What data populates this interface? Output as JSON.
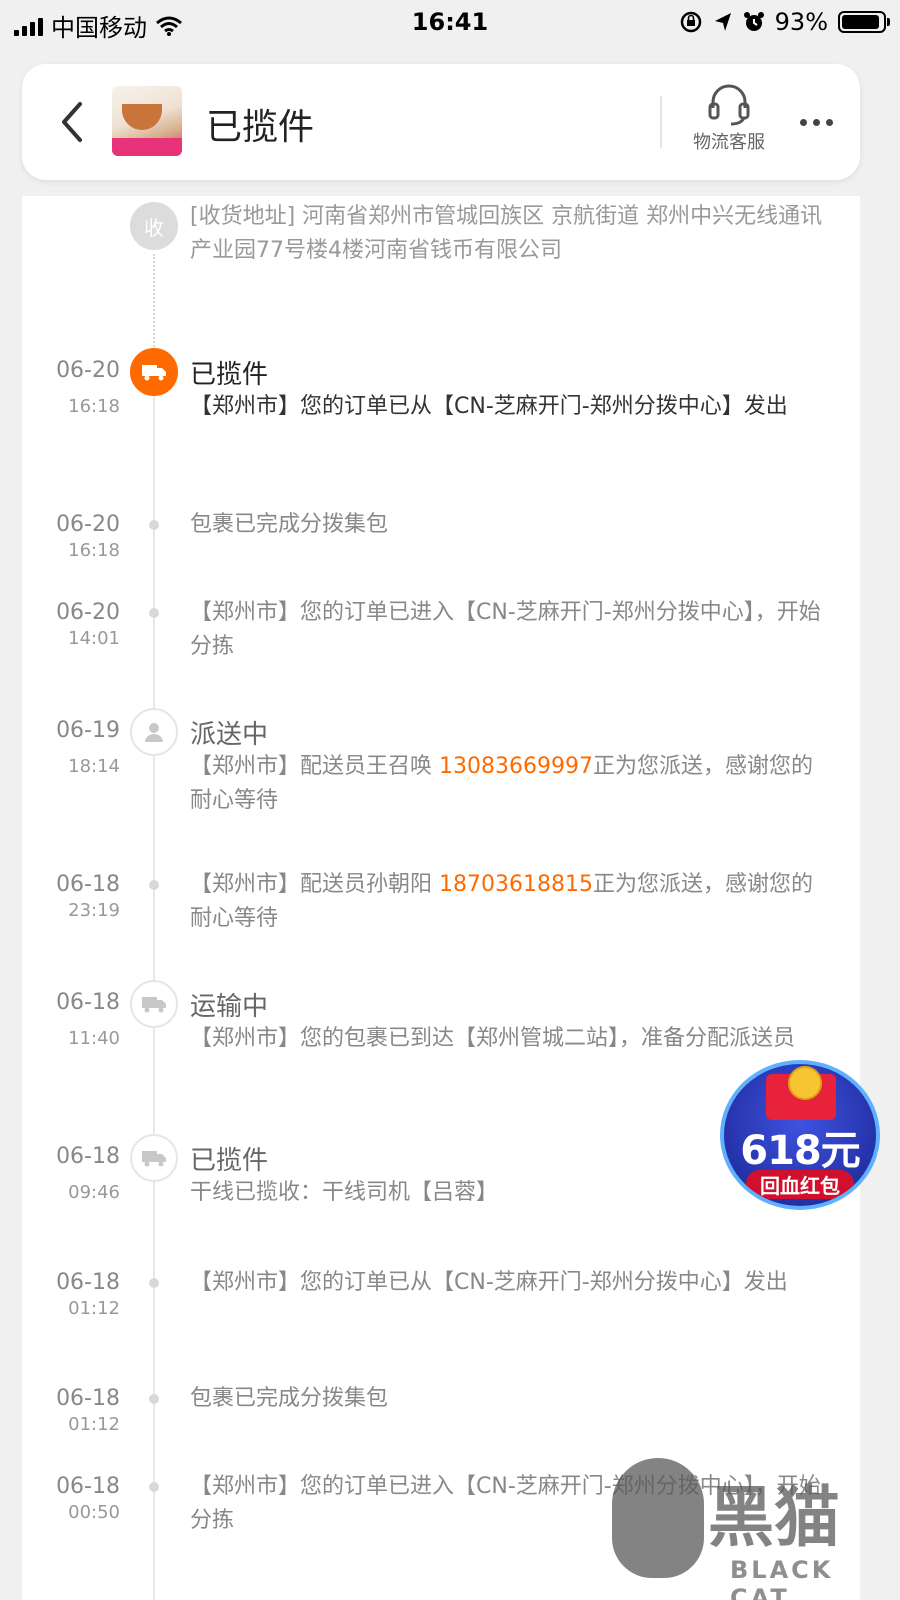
{
  "status_bar": {
    "carrier": "中国移动",
    "time": "16:41",
    "battery_text": "93%",
    "battery_level": 0.93,
    "icons": [
      "signal-icon",
      "wifi-icon",
      "rotation-lock-icon",
      "location-icon",
      "alarm-icon",
      "battery-icon"
    ]
  },
  "header": {
    "title": "已揽件",
    "service_label": "物流客服",
    "icons": [
      "back-arrow-icon",
      "headset-icon",
      "more-icon"
    ]
  },
  "address": {
    "text": "[收货地址] 河南省郑州市管城回族区 京航街道 郑州中兴无线通讯产业园77号楼4楼河南省钱币有限公司",
    "marker_label": "收"
  },
  "events": [
    {
      "date": "06-20",
      "time": "16:18",
      "status": "已揽件",
      "desc": "【郑州市】您的订单已从【CN-芝麻开门-郑州分拨中心】发出",
      "icon": "truck-icon",
      "active": true
    },
    {
      "date": "06-20",
      "time": "16:18",
      "status": "",
      "desc": "包裹已完成分拨集包"
    },
    {
      "date": "06-20",
      "time": "14:01",
      "status": "",
      "desc": "【郑州市】您的订单已进入【CN-芝麻开门-郑州分拨中心】，开始分拣"
    },
    {
      "date": "06-19",
      "time": "18:14",
      "status": "派送中",
      "desc_pre": "【郑州市】配送员王召唤 ",
      "phone": "13083669997",
      "desc_post": "正为您派送，感谢您的耐心等待",
      "icon": "person-icon"
    },
    {
      "date": "06-18",
      "time": "23:19",
      "status": "",
      "desc_pre": "【郑州市】配送员孙朝阳 ",
      "phone": "18703618815",
      "desc_post": "正为您派送，感谢您的耐心等待"
    },
    {
      "date": "06-18",
      "time": "11:40",
      "status": "运输中",
      "desc": "【郑州市】您的包裹已到达【郑州管城二站】，准备分配派送员",
      "icon": "truck-icon"
    },
    {
      "date": "06-18",
      "time": "09:46",
      "status": "已揽件",
      "desc": "干线已揽收：干线司机【吕蓉】",
      "icon": "truck-icon"
    },
    {
      "date": "06-18",
      "time": "01:12",
      "status": "",
      "desc": "【郑州市】您的订单已从【CN-芝麻开门-郑州分拨中心】发出"
    },
    {
      "date": "06-18",
      "time": "01:12",
      "status": "",
      "desc": "包裹已完成分拨集包"
    },
    {
      "date": "06-18",
      "time": "00:50",
      "status": "",
      "desc": "【郑州市】您的订单已进入【CN-芝麻开门-郑州分拨中心】，开始分拣"
    }
  ],
  "promo": {
    "amount": "618元",
    "label": "回血红包"
  },
  "watermark": {
    "cn": "黑猫",
    "en": "BLACK CAT"
  },
  "colors": {
    "accent": "#ff6a00",
    "promo_blue": "#2432a8",
    "promo_red": "#d1102e"
  }
}
